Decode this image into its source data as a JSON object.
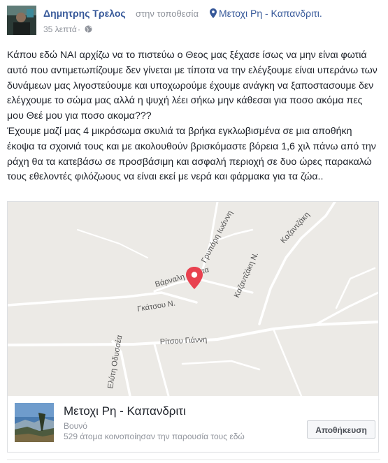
{
  "post": {
    "author": "Δημητρης Τρελος",
    "at_label": "στην τοποθεσία",
    "place": "Μετοχι Ρη - Καπανδριτι.",
    "time": "35 λεπτά",
    "dot": "·",
    "body": [
      "Κάπου εδώ ΝΑΙ αρχίζω να το πιστεύω ο Θεος μας ξέχασε ίσως να μην είναι φωτιά αυτό που αντιμετωπίζουμε δεν γίνεται με τίποτα να την ελέγξουμε είναι υπεράνω των δυνάμεων μας λιγοστεύουμε και υποχωρούμε έχουμε ανάγκη να ξαποστασουμε δεν ελέγχουμε το σώμα μας αλλά η ψυχή λέει σήκω μην κάθεσαι για ποσο ακόμα πες μου Θεέ μου για ποσο ακομα???",
      "Έχουμε μαζί μας 4 μικρόσωμα σκυλιά τα βρήκα εγκλωβισμένα σε μια αποθήκη έκοψα τα σχοινιά τους και με ακολουθούν βρισκόμαστε βόρεια 1,6 χιλ πάνω από την ράχη θα τα κατεβάσω σε προσβάσιμη και ασφαλή περιοχή σε δυο ώρες παρακαλώ τους εθελοντές φιλόζωους να είναι εκεί με νερά και φάρμακα για τα ζώα.."
    ]
  },
  "map": {
    "streets": {
      "griparh": "Γρυπάρη Ιωάννη",
      "kazantzaki_top": "Καζαντζάκη",
      "kazantzaki_n": "Καζαντζάκη Ν.",
      "varnali": "Βάρναλη Κώστα",
      "gkatsou": "Γκάτσου Ν.",
      "ritsou": "Ρίτσου Γιάννη",
      "elyti": "Ελύτη Οδυσσέα"
    },
    "colors": {
      "pin": "#e8414f",
      "road": "#ffffff",
      "land": "#eceae6"
    }
  },
  "place_card": {
    "title": "Μετοχι Ρη - Καπανδριτι",
    "category": "Βουνό",
    "count": "529 άτομα κοινοποίησαν την παρουσία τους εδώ",
    "save": "Αποθήκευση"
  }
}
